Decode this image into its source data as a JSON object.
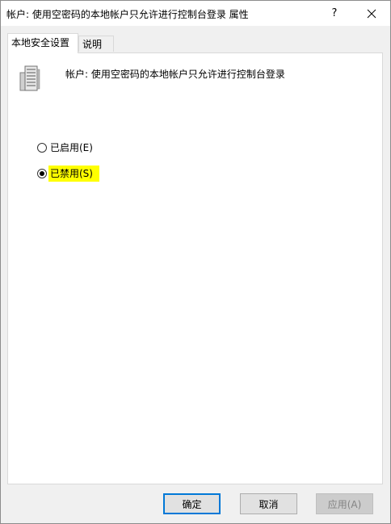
{
  "window": {
    "title": "帐户: 使用空密码的本地帐户只允许进行控制台登录 属性",
    "help_label": "?",
    "close_label": "✕"
  },
  "tabs": [
    {
      "label": "本地安全设置",
      "active": true
    },
    {
      "label": "说明",
      "active": false
    }
  ],
  "policy": {
    "icon": "server-computer-icon",
    "title": "帐户: 使用空密码的本地帐户只允许进行控制台登录"
  },
  "options": {
    "enabled_label": "已启用(E)",
    "disabled_label": "已禁用(S)",
    "selected": "disabled"
  },
  "buttons": {
    "ok_label": "确定",
    "cancel_label": "取消",
    "apply_label": "应用(A)"
  },
  "colors": {
    "highlight": "#ffff00",
    "focus_border": "#0078d7"
  }
}
